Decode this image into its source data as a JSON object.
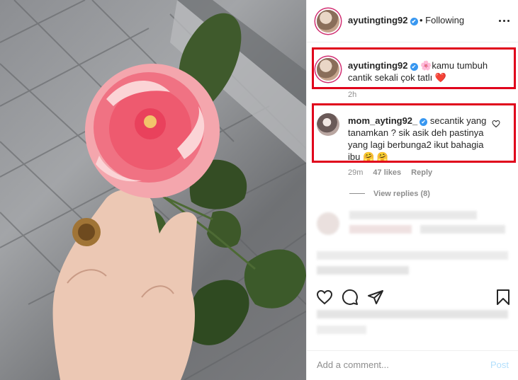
{
  "post": {
    "author": "ayutingting92",
    "follow_state": "• Following",
    "caption": {
      "username": "ayutingting92",
      "emoji": "🌸",
      "text": "kamu tumbuh cantik sekali çok tatlı ",
      "heart": "❤️",
      "time": "2h"
    }
  },
  "comment": {
    "username": "mom_ayting92_",
    "text": "secantik yang tanamkan ? sik asik deh pastinya yang lagi berbunga2 ikut bahagia ibu ",
    "emojis": "🤗 🤗",
    "time": "29m",
    "likes": "47 likes",
    "reply": "Reply",
    "view_replies": "View replies (8)"
  },
  "composer": {
    "placeholder": "Add a comment...",
    "post_label": "Post"
  },
  "icons": {
    "verified": "✔",
    "more": "more-options-icon",
    "heart": "heart-icon",
    "comment": "comment-icon",
    "share": "share-icon",
    "save": "bookmark-icon"
  },
  "colors": {
    "highlight": "#e0001b",
    "verified": "#3897f0",
    "post_disabled": "#b2dffc"
  }
}
